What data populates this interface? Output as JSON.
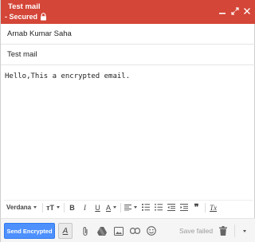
{
  "header": {
    "title": "Test mail",
    "secured_label": "- Secured",
    "icons": [
      "lock-icon",
      "minimize-icon",
      "expand-icon",
      "close-icon"
    ],
    "background_color": "#d44638"
  },
  "fields": {
    "to": "Arnab Kumar Saha",
    "subject": "Test mail"
  },
  "body": {
    "text": "Hello,This a encrypted email."
  },
  "format_toolbar": {
    "font": "Verdana",
    "size_label": "тT",
    "bold": "B",
    "italic": "I",
    "underline": "U",
    "text_color": "A",
    "quote": "❞",
    "remove_format": "Tx"
  },
  "bottom_bar": {
    "send_label": "Send Encrypted",
    "format_label": "A",
    "save_status": "Save failed",
    "send_color": "#4d90fe"
  }
}
